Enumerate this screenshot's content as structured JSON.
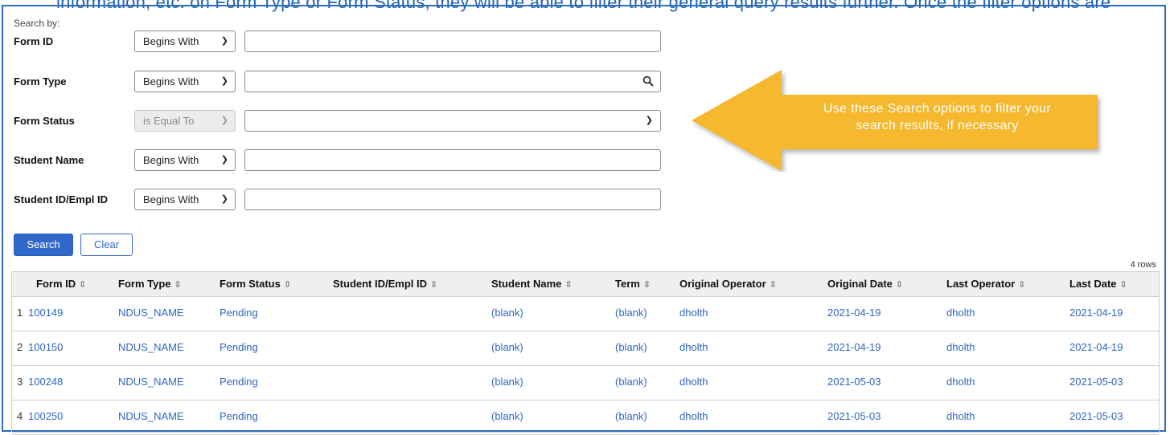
{
  "cutoff_text": "information, etc. on  Form Type or Form Status, they will be able to filter their general query results further. Once the filter options are",
  "search_by_label": "Search by:",
  "criteria": [
    {
      "label": "Form ID",
      "operator": "Begins With",
      "value": "",
      "kind": "text"
    },
    {
      "label": "Form Type",
      "operator": "Begins With",
      "value": "",
      "kind": "lookup"
    },
    {
      "label": "Form Status",
      "operator": "is Equal To",
      "value": "",
      "kind": "select",
      "operator_disabled": true
    },
    {
      "label": "Student Name",
      "operator": "Begins With",
      "value": "",
      "kind": "text"
    },
    {
      "label": "Student ID/Empl ID",
      "operator": "Begins With",
      "value": "",
      "kind": "text"
    }
  ],
  "buttons": {
    "search": "Search",
    "clear": "Clear"
  },
  "row_count": "4 rows",
  "columns": [
    "Form ID",
    "Form Type",
    "Form Status",
    "Student ID/Empl ID",
    "Student Name",
    "Term",
    "Original Operator",
    "Original Date",
    "Last Operator",
    "Last Date"
  ],
  "rows": [
    {
      "num": "1",
      "form_id": "100149",
      "form_type": "NDUS_NAME",
      "form_status": "Pending",
      "student_id": "",
      "student_name": "(blank)",
      "term": "(blank)",
      "orig_operator": "dholth",
      "orig_date": "2021-04-19",
      "last_operator": "dholth",
      "last_date": "2021-04-19"
    },
    {
      "num": "2",
      "form_id": "100150",
      "form_type": "NDUS_NAME",
      "form_status": "Pending",
      "student_id": "",
      "student_name": "(blank)",
      "term": "(blank)",
      "orig_operator": "dholth",
      "orig_date": "2021-04-19",
      "last_operator": "dholth",
      "last_date": "2021-04-19"
    },
    {
      "num": "3",
      "form_id": "100248",
      "form_type": "NDUS_NAME",
      "form_status": "Pending",
      "student_id": "",
      "student_name": "(blank)",
      "term": "(blank)",
      "orig_operator": "dholth",
      "orig_date": "2021-05-03",
      "last_operator": "dholth",
      "last_date": "2021-05-03"
    },
    {
      "num": "4",
      "form_id": "100250",
      "form_type": "NDUS_NAME",
      "form_status": "Pending",
      "student_id": "",
      "student_name": "(blank)",
      "term": "(blank)",
      "orig_operator": "dholth",
      "orig_date": "2021-05-03",
      "last_operator": "dholth",
      "last_date": "2021-05-03"
    }
  ],
  "callout": {
    "line1": "Use these Search options to filter your",
    "line2": "search results, if necessary"
  },
  "colors": {
    "accent": "#3069c9",
    "link": "#2e66c2",
    "frame": "#2f6cc0",
    "callout": "#f5b82e"
  },
  "icons": {
    "lookup": "search-icon",
    "dropdown": "chevron-down-icon",
    "sort": "sort-icon"
  }
}
